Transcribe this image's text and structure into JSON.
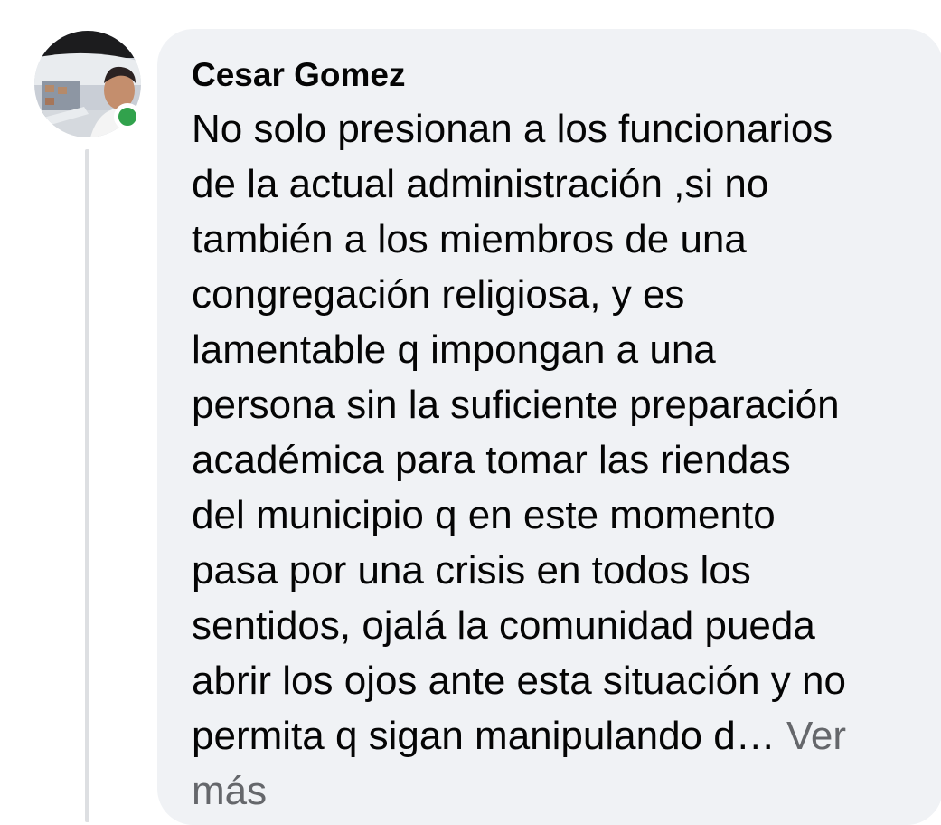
{
  "comment": {
    "author": "Cesar Gomez",
    "online": true,
    "lines": [
      "No solo presionan a los funcionarios",
      "de la actual administración ,si no",
      "también a los miembros de una",
      "congregación religiosa, y es",
      "lamentable q impongan a una",
      "persona sin la suficiente preparación",
      "académica para tomar las riendas",
      "del municipio q en este momento",
      "pasa por una crisis en todos los",
      "sentidos, ojalá la comunidad pueda",
      "abrir los ojos ante esta situación y no",
      "permita q sigan manipulando d…"
    ],
    "see_more_1": "Ver",
    "see_more_2": "más"
  },
  "colors": {
    "bubble": "#f0f2f5",
    "text": "#050505",
    "secondary": "#65676b",
    "presence": "#31a24c"
  }
}
